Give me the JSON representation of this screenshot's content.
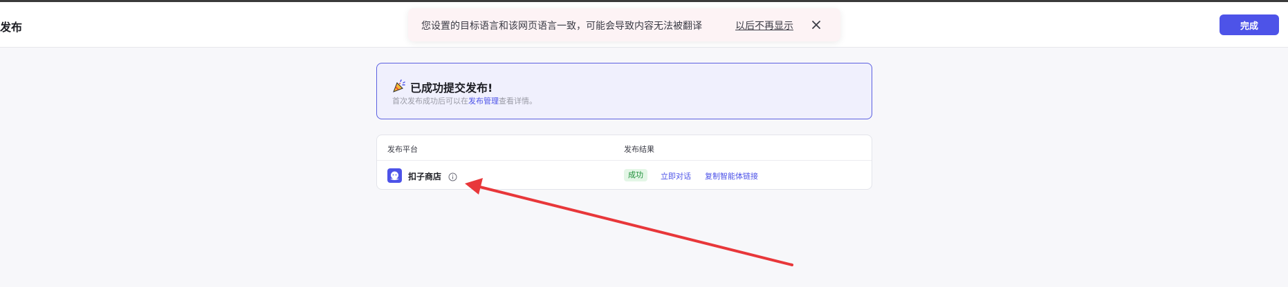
{
  "header": {
    "title": "发布",
    "done_label": "完成"
  },
  "toast": {
    "message": "您设置的目标语言和该网页语言一致，可能会导致内容无法被翻译",
    "dismiss_label": "以后不再显示",
    "close_icon": "close-icon"
  },
  "success": {
    "icon": "party-popper-icon",
    "title": "已成功提交发布!",
    "desc_prefix": "首次发布成功后可以在",
    "desc_link": "发布管理",
    "desc_suffix": "查看详情。"
  },
  "table": {
    "headers": {
      "platform": "发布平台",
      "result": "发布结果"
    },
    "rows": [
      {
        "platform": "扣子商店",
        "status": "成功",
        "chat_label": "立即对话",
        "copy_label": "复制智能体链接"
      }
    ]
  },
  "colors": {
    "accent": "#4d53e8",
    "success": "#1f8f3a",
    "annotation": "#e8373a"
  }
}
